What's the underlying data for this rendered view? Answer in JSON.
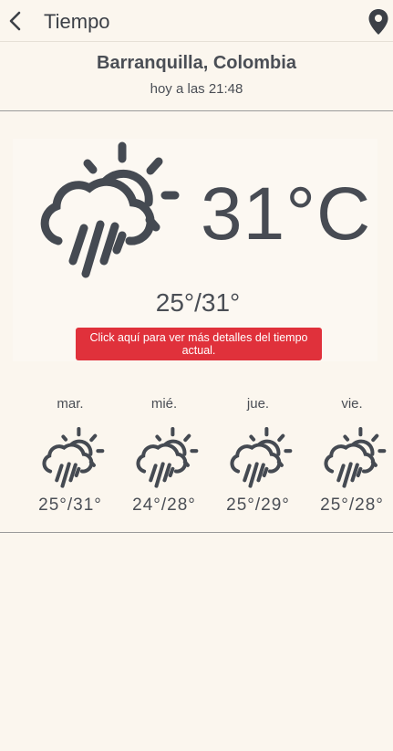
{
  "appbar": {
    "title": "Tiempo"
  },
  "location": {
    "name": "Barranquilla, Colombia",
    "updated": "hoy a las 21:48"
  },
  "current": {
    "icon": "rain-sun-icon",
    "temperature": "31°C",
    "range": "25°/31°",
    "details_button": "Click aquí para ver más detalles del tiempo actual."
  },
  "forecast": [
    {
      "day": "mar.",
      "icon": "rain-sun-icon",
      "range": "25°/31°"
    },
    {
      "day": "mié.",
      "icon": "rain-sun-icon",
      "range": "24°/28°"
    },
    {
      "day": "jue.",
      "icon": "rain-sun-icon",
      "range": "25°/29°"
    },
    {
      "day": "vie.",
      "icon": "rain-sun-icon",
      "range": "25°/28°"
    }
  ],
  "colors": {
    "background": "#fbf6ee",
    "accent": "#e0313b",
    "text": "#454a52"
  }
}
